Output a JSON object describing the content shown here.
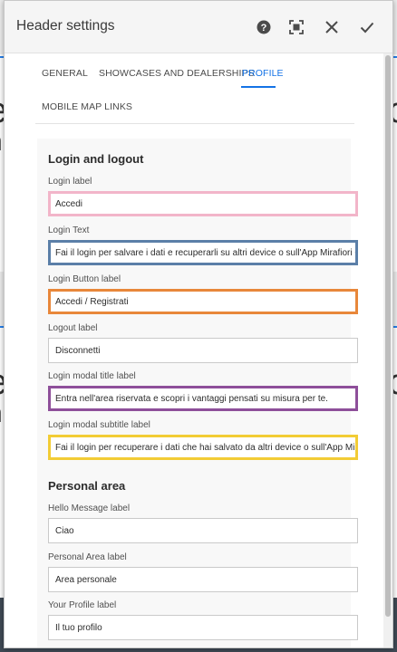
{
  "dialog": {
    "title": "Header settings",
    "icons": [
      "help-icon",
      "fullscreen-icon",
      "close-icon",
      "check-icon"
    ]
  },
  "tabs": [
    {
      "label": "GENERAL",
      "active": false
    },
    {
      "label": "SHOWCASES AND DEALERSHIPS",
      "active": false
    },
    {
      "label": "PROFILE",
      "active": true
    },
    {
      "label": "MOBILE MAP LINKS",
      "active": false
    }
  ],
  "sections": {
    "login": {
      "title": "Login and logout",
      "fields": [
        {
          "label": "Login label",
          "value": "Accedi",
          "highlight": "#f2b5c9"
        },
        {
          "label": "Login Text",
          "value": "Fai il login per salvare i dati e recuperarli su altri device o sull'App Mirafiori Outlet",
          "highlight": "#5b7fa8"
        },
        {
          "label": "Login Button label",
          "value": "Accedi / Registrati",
          "highlight": "#e8873a"
        },
        {
          "label": "Logout label",
          "value": "Disconnetti",
          "highlight": ""
        },
        {
          "label": "Login modal title label",
          "value": "Entra nell'area riservata e scopri i vantaggi pensati su misura per te.",
          "highlight": "#8e4f9a"
        },
        {
          "label": "Login modal subtitle label",
          "value": "Fai il login per recuperare i dati che hai salvato da altri device o sull'App Mirafiori",
          "highlight": "#f2cc35"
        }
      ]
    },
    "personal": {
      "title": "Personal area",
      "fields": [
        {
          "label": "Hello Message label",
          "value": "Ciao"
        },
        {
          "label": "Personal Area label",
          "value": "Area personale"
        },
        {
          "label": "Your Profile label",
          "value": "Il tuo profilo"
        }
      ]
    }
  },
  "colors": {
    "accent": "#1473e6"
  }
}
